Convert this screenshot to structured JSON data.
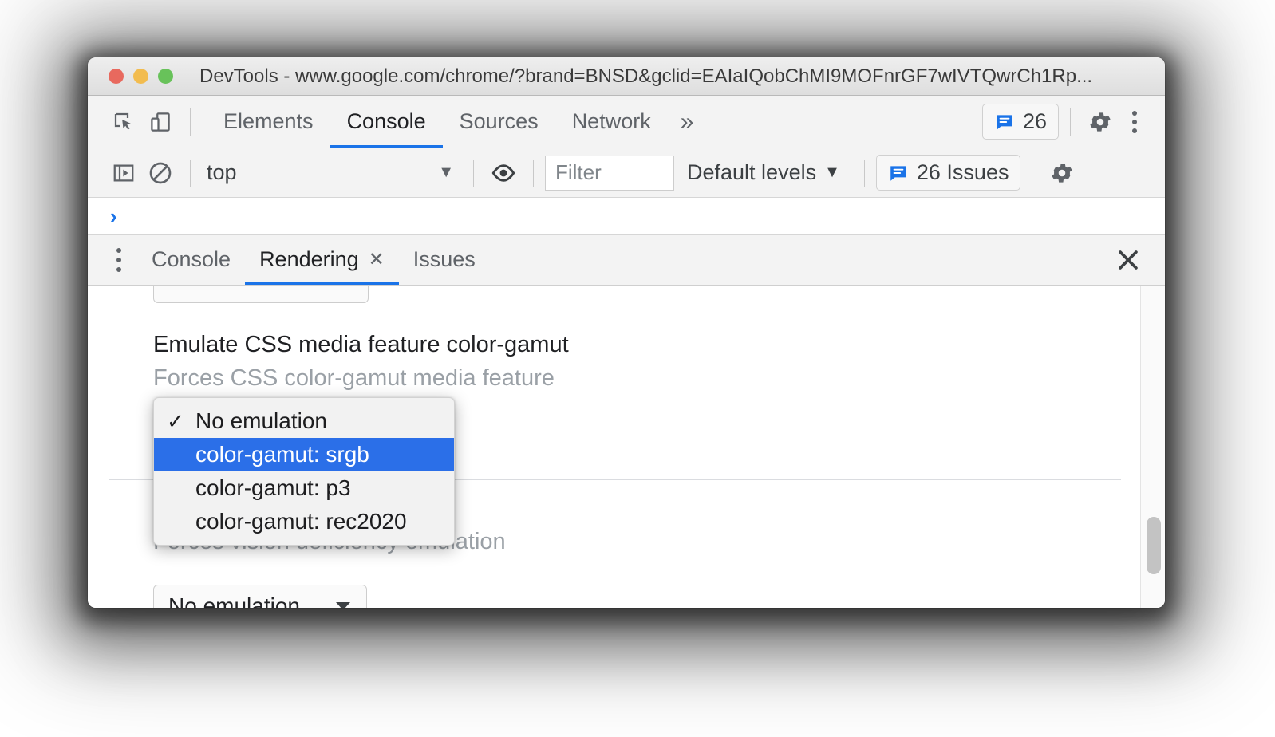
{
  "window": {
    "title": "DevTools - www.google.com/chrome/?brand=BNSD&gclid=EAIaIQobChMI9MOFnrGF7wIVTQwrCh1Rp...",
    "traffic_lights": {
      "close_color": "#e8695e",
      "minimize_color": "#f2bc4f",
      "zoom_color": "#68c25a"
    }
  },
  "main_toolbar": {
    "inspect_icon": "inspect-element-icon",
    "device_icon": "device-toolbar-icon",
    "tabs": [
      {
        "label": "Elements",
        "active": false
      },
      {
        "label": "Console",
        "active": true
      },
      {
        "label": "Sources",
        "active": false
      },
      {
        "label": "Network",
        "active": false
      }
    ],
    "more_tabs_label": "»",
    "issues_count": "26",
    "issues_icon": "issue-message-icon",
    "settings_icon": "gear-icon",
    "menu_icon": "kebab-menu-icon"
  },
  "console_toolbar": {
    "sidebar_toggle_icon": "console-sidebar-icon",
    "clear_icon": "clear-console-icon",
    "context_value": "top",
    "context_caret": "▼",
    "eye_icon": "live-expression-eye-icon",
    "filter_placeholder": "Filter",
    "filter_value": "",
    "levels_label": "Default levels",
    "levels_caret": "▼",
    "issues_label": "26 Issues",
    "issues_icon": "issue-message-icon",
    "settings_icon": "gear-icon"
  },
  "console_prompt": {
    "chevron": "›"
  },
  "drawer": {
    "menu_icon": "kebab-menu-icon",
    "tabs": [
      {
        "label": "Console",
        "active": false,
        "closable": false
      },
      {
        "label": "Rendering",
        "active": true,
        "closable": true,
        "close_glyph": "✕"
      },
      {
        "label": "Issues",
        "active": false,
        "closable": false
      }
    ],
    "close_icon": "close-drawer-icon"
  },
  "rendering": {
    "gamut": {
      "title": "Emulate CSS media feature color-gamut",
      "description": "Forces CSS color-gamut media feature",
      "select_value": "No emulation"
    },
    "vision": {
      "description": "Forces vision deficiency emulation",
      "select_value": "No emulation"
    }
  },
  "dropdown_menu": {
    "highlight_color": "#2b6fe8",
    "items": [
      {
        "label": "No emulation",
        "checked": true,
        "selected": false
      },
      {
        "label": "color-gamut: srgb",
        "checked": false,
        "selected": true
      },
      {
        "label": "color-gamut: p3",
        "checked": false,
        "selected": false
      },
      {
        "label": "color-gamut: rec2020",
        "checked": false,
        "selected": false
      }
    ],
    "check_glyph": "✓"
  },
  "scrollbar": {
    "name": "rendering-pane-scrollbar"
  }
}
